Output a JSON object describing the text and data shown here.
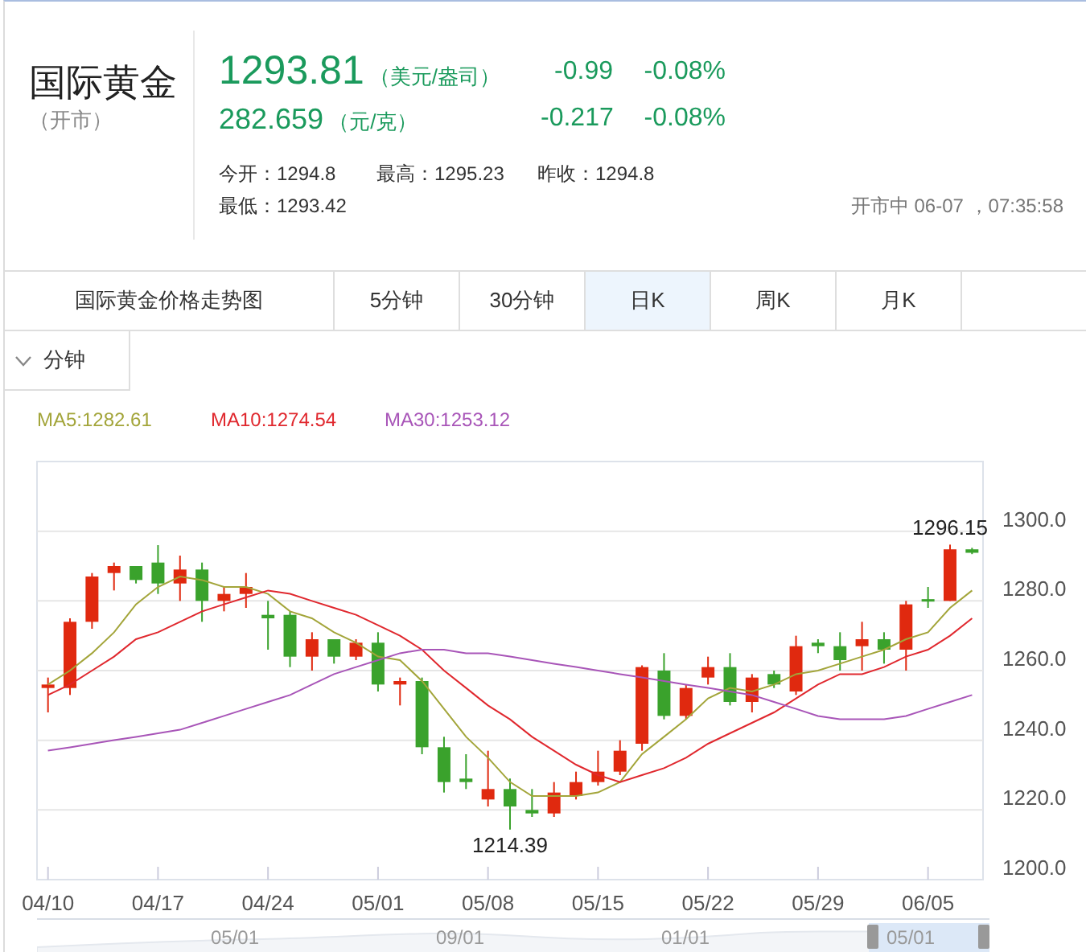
{
  "instrument": {
    "name": "国际黄金",
    "status": "（开市）"
  },
  "quotes": [
    {
      "price": "1293.81",
      "unit": "（美元/盎司）",
      "change": "-0.99",
      "change_pct": "-0.08%",
      "kind": "main"
    },
    {
      "price": "282.659",
      "unit": "（元/克）",
      "change": "-0.217",
      "change_pct": "-0.08%",
      "kind": "secondary"
    }
  ],
  "stats": [
    "今开：1294.8",
    "最高：1295.23",
    "昨收：1294.8",
    "最低：1293.42"
  ],
  "market_time": "开市中 06-07 ，07:35:58",
  "tabs": [
    {
      "label": "国际黄金价格走势图",
      "selected": false
    },
    {
      "label": "5分钟",
      "selected": false
    },
    {
      "label": "30分钟",
      "selected": false
    },
    {
      "label": "日K",
      "selected": true
    },
    {
      "label": "周K",
      "selected": false
    },
    {
      "label": "月K",
      "selected": false
    }
  ],
  "period_dropdown": {
    "label": "分钟",
    "expanded": false
  },
  "chart": {
    "chart_data": {
      "type": "candlestick",
      "ylim": [
        1200,
        1320
      ],
      "grid": true,
      "yticks": [
        {
          "value": 1200,
          "label": "1200.0"
        },
        {
          "value": 1220,
          "label": "1220.0"
        },
        {
          "value": 1240,
          "label": "1240.0"
        },
        {
          "value": 1260,
          "label": "1260.0"
        },
        {
          "value": 1280,
          "label": "1280.0"
        },
        {
          "value": 1300,
          "label": "1300.0"
        }
      ],
      "categories": [
        "04/10",
        null,
        null,
        null,
        null,
        "04/17",
        null,
        null,
        null,
        null,
        "04/24",
        null,
        null,
        null,
        null,
        "05/01",
        null,
        null,
        null,
        null,
        "05/08",
        null,
        null,
        null,
        null,
        "05/15",
        null,
        null,
        null,
        null,
        "05/22",
        null,
        null,
        null,
        null,
        "05/29",
        null,
        null,
        null,
        null,
        "06/05",
        null,
        null
      ],
      "ohlc": [
        [
          1255,
          1258,
          1248,
          1256
        ],
        [
          1255,
          1275,
          1253,
          1274
        ],
        [
          1274,
          1288,
          1272,
          1287
        ],
        [
          1288,
          1291,
          1283,
          1290
        ],
        [
          1290,
          1290,
          1285,
          1286
        ],
        [
          1291,
          1296,
          1282,
          1285
        ],
        [
          1285,
          1293,
          1280,
          1289
        ],
        [
          1289,
          1291,
          1274,
          1280
        ],
        [
          1280,
          1284,
          1277,
          1282
        ],
        [
          1282,
          1288,
          1278,
          1284
        ],
        [
          1276,
          1280,
          1266,
          1275
        ],
        [
          1276,
          1277,
          1261,
          1264
        ],
        [
          1264,
          1271,
          1260,
          1269
        ],
        [
          1269,
          1269,
          1262,
          1264
        ],
        [
          1264,
          1269,
          1263,
          1268
        ],
        [
          1268,
          1271,
          1254,
          1256
        ],
        [
          1256,
          1258,
          1250,
          1257
        ],
        [
          1257,
          1258,
          1236,
          1238
        ],
        [
          1238,
          1241,
          1225,
          1228
        ],
        [
          1229,
          1236,
          1226,
          1228
        ],
        [
          1223,
          1237,
          1221,
          1226
        ],
        [
          1226,
          1229,
          1214.39,
          1221
        ],
        [
          1220,
          1226,
          1218,
          1219
        ],
        [
          1219,
          1228,
          1218,
          1225
        ],
        [
          1224,
          1231,
          1223,
          1228
        ],
        [
          1228,
          1237,
          1227,
          1231
        ],
        [
          1231,
          1240,
          1230,
          1237
        ],
        [
          1239,
          1261.5,
          1237,
          1261
        ],
        [
          1260,
          1265,
          1246,
          1247
        ],
        [
          1247,
          1256,
          1246,
          1255
        ],
        [
          1258,
          1264,
          1256,
          1261
        ],
        [
          1261,
          1265,
          1250,
          1251
        ],
        [
          1251,
          1259,
          1248,
          1258
        ],
        [
          1259,
          1260,
          1255,
          1256
        ],
        [
          1254,
          1270,
          1253,
          1267
        ],
        [
          1268,
          1269,
          1265,
          1267
        ],
        [
          1267,
          1271,
          1260,
          1263
        ],
        [
          1267,
          1274,
          1260,
          1269
        ],
        [
          1269,
          1271,
          1262,
          1266
        ],
        [
          1266,
          1280,
          1260,
          1279
        ],
        [
          1280.5,
          1284,
          1278,
          1280
        ],
        [
          1280,
          1296.15,
          1280,
          1294.8
        ],
        [
          1294.8,
          1295.23,
          1293.42,
          1293.81
        ]
      ],
      "series": [
        {
          "name": "MA5:1282.61",
          "type": "line",
          "color": "#a3a53a",
          "values": [
            1256,
            1260,
            1265,
            1271,
            1279,
            1284,
            1287,
            1286,
            1284,
            1284,
            1282,
            1277,
            1275,
            1271,
            1268,
            1264,
            1263,
            1257,
            1249,
            1241,
            1235,
            1228,
            1224,
            1224,
            1224,
            1225,
            1228,
            1236,
            1241,
            1246,
            1252,
            1255,
            1254,
            1256,
            1259,
            1260,
            1262,
            1264,
            1266,
            1269,
            1271,
            1278,
            1283
          ]
        },
        {
          "name": "MA10:1274.54",
          "type": "line",
          "color": "#e0282e",
          "values": [
            1253,
            1256,
            1260,
            1264,
            1269,
            1271,
            1274,
            1277,
            1279,
            1281,
            1283,
            1282,
            1280,
            1278,
            1276,
            1273,
            1270,
            1266,
            1260,
            1255,
            1250,
            1246,
            1241,
            1237,
            1233,
            1230,
            1228,
            1230,
            1232,
            1235,
            1239,
            1242,
            1245,
            1248,
            1252,
            1256,
            1259,
            1259,
            1261,
            1264,
            1266,
            1270,
            1275
          ]
        },
        {
          "name": "MA30:1253.12",
          "type": "line",
          "color": "#a855b8",
          "values": [
            1237,
            1238,
            1239,
            1240,
            1241,
            1242,
            1243,
            1245,
            1247,
            1249,
            1251,
            1253,
            1256,
            1259,
            1261,
            1263,
            1265,
            1266,
            1266,
            1265,
            1265,
            1264,
            1263,
            1262,
            1261,
            1260,
            1259,
            1258,
            1257,
            1256,
            1255,
            1254,
            1253,
            1251,
            1249,
            1247,
            1246,
            1246,
            1246,
            1247,
            1249,
            1251,
            1253
          ]
        }
      ],
      "annotations": [
        {
          "text": "1296.15"
        },
        {
          "text": "1214.39"
        }
      ]
    }
  },
  "navigator": {
    "labels": [
      "05/01",
      "09/01",
      "01/01",
      "05/01"
    ]
  }
}
